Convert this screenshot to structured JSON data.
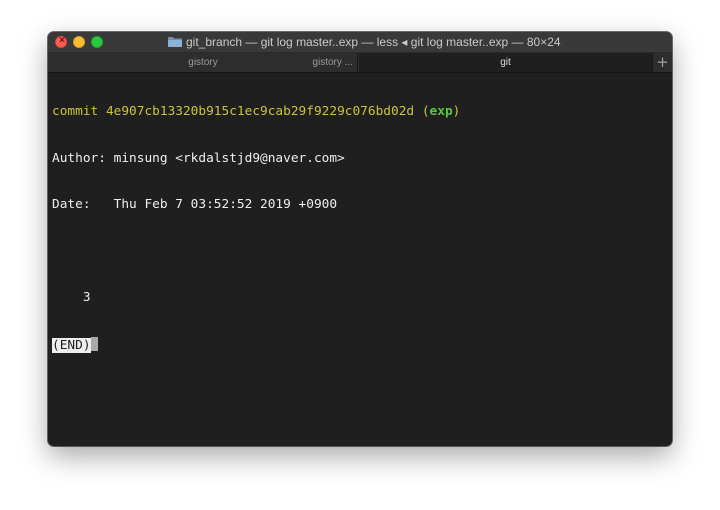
{
  "window": {
    "title": "git_branch — git log master..exp — less ◂ git log master..exp — 80×24"
  },
  "tabs": [
    {
      "label": "gistory",
      "secondary": "gistory ..."
    },
    {
      "label": "git"
    }
  ],
  "new_tab_label": "+",
  "terminal": {
    "commit_prefix": "commit ",
    "commit_hash": "4e907cb13320b915c1ec9cab29f9229c076bd02d",
    "ref_open": " (",
    "ref_name": "exp",
    "ref_close": ")",
    "author_line": "Author: minsung <rkdalstjd9@naver.com>",
    "date_line": "Date:   Thu Feb 7 03:52:52 2019 +0900",
    "message_line": "    3",
    "end_marker": "(END)"
  },
  "colors": {
    "traffic_close": "#fe5f57",
    "traffic_minimize": "#febc2e",
    "traffic_zoom": "#28c840",
    "commit_text": "#c9c53a",
    "branch_ref": "#58c845",
    "terminal_bg": "#1f1f1f",
    "terminal_fg": "#eeeeee"
  },
  "icons": {
    "title_icon": "folder-icon",
    "close": "close-icon"
  }
}
